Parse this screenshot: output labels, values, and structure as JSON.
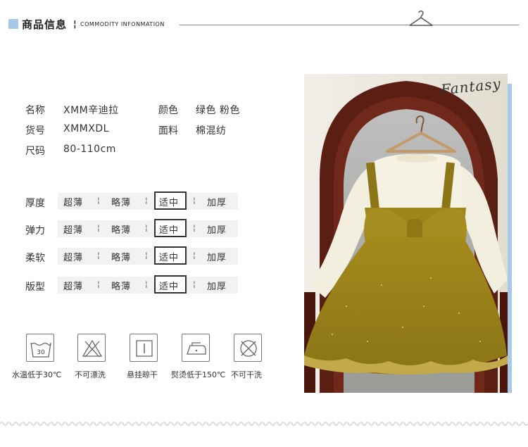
{
  "header": {
    "title": "商品信息",
    "separator": "¦",
    "subtitle": "COMMODITY INFONMATION"
  },
  "info": {
    "name_label": "名称",
    "name_value": "XMM辛迪拉",
    "color_label": "颜色",
    "color_value": "绿色 粉色",
    "code_label": "货号",
    "code_value": "XMMXDL",
    "fabric_label": "面料",
    "fabric_value": "棉混纺",
    "size_label": "尺码",
    "size_value": "80-110cm"
  },
  "scales": [
    {
      "label": "厚度",
      "options": [
        "超薄",
        "略薄",
        "适中",
        "加厚"
      ],
      "selected": "适中"
    },
    {
      "label": "弹力",
      "options": [
        "超薄",
        "略薄",
        "适中",
        "加厚"
      ],
      "selected": "适中"
    },
    {
      "label": "柔软",
      "options": [
        "超薄",
        "略薄",
        "适中",
        "加厚"
      ],
      "selected": "适中"
    },
    {
      "label": "版型",
      "options": [
        "超薄",
        "略薄",
        "适中",
        "加厚"
      ],
      "selected": "适中"
    }
  ],
  "scale_separator": "¦",
  "care": [
    {
      "icon": "wash-30-icon",
      "label": "水温低于30℃",
      "badge": "30"
    },
    {
      "icon": "no-bleach-icon",
      "label": "不可漂洗"
    },
    {
      "icon": "hang-dry-icon",
      "label": "悬挂晾干"
    },
    {
      "icon": "iron-low-icon",
      "label": "熨烫低于150℃"
    },
    {
      "icon": "no-dry-clean-icon",
      "label": "不可干洗"
    }
  ],
  "photo": {
    "watermark": "Fantasy"
  },
  "colors": {
    "accent": "#a8c8e8",
    "dress_olive": "#a08a1e",
    "mirror_wood": "#5a1e12",
    "sweater": "#f3efdf"
  }
}
